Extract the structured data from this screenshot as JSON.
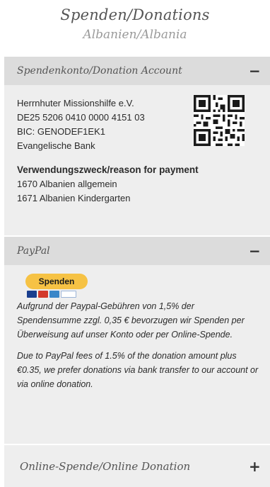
{
  "page": {
    "title": "Spenden/Donations",
    "subtitle": "Albanien/Albania"
  },
  "bank": {
    "heading": "Spendenkonto/Donation Account",
    "toggle": "−",
    "lines": [
      "Herrnhuter Missionshilfe e.V.",
      "DE25 5206 0410 0000 4151 03",
      "BIC: GENODEF1EK1",
      "Evangelische Bank"
    ],
    "purpose_heading": "Verwendungszweck/reason for payment",
    "purposes": [
      "1670 Albanien allgemein",
      "1671 Albanien Kindergarten"
    ]
  },
  "paypal": {
    "heading": "PayPal",
    "toggle": "−",
    "button_label": "Spenden",
    "text_de": "Aufgrund der Paypal-Gebühren von 1,5% der Spendensumme zzgl. 0,35 € bevorzugen wir Spenden per Überweisung auf unser Konto oder per Online-Spende.",
    "text_en": "Due to PayPal fees of 1.5% of the donation amount plus €0.35, we prefer donations via bank transfer to our account or via online donation."
  },
  "online": {
    "heading": "Online-Spende/Online Donation",
    "toggle": "+"
  },
  "colors": {
    "header_bg": "#dcdcdc",
    "body_bg": "#eeeeee",
    "paypal_yellow": "#f6c244"
  }
}
